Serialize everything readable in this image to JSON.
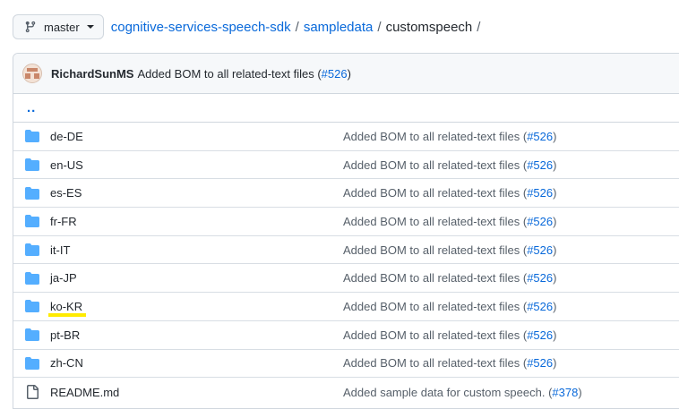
{
  "branch": {
    "label": "master",
    "icon": "git-branch-icon"
  },
  "breadcrumb": {
    "repo": "cognitive-services-speech-sdk",
    "folder": "sampledata",
    "current": "customspeech",
    "separator": "/"
  },
  "latest_commit": {
    "author": "RichardSunMS",
    "message": "Added BOM to all related-text files (",
    "pr": "#526",
    "suffix": ")"
  },
  "parent_link": "..",
  "files": [
    {
      "name": "de-DE",
      "type": "folder",
      "msg": "Added BOM to all related-text files (",
      "pr": "#526",
      "suffix": ")"
    },
    {
      "name": "en-US",
      "type": "folder",
      "msg": "Added BOM to all related-text files (",
      "pr": "#526",
      "suffix": ")"
    },
    {
      "name": "es-ES",
      "type": "folder",
      "msg": "Added BOM to all related-text files (",
      "pr": "#526",
      "suffix": ")"
    },
    {
      "name": "fr-FR",
      "type": "folder",
      "msg": "Added BOM to all related-text files (",
      "pr": "#526",
      "suffix": ")"
    },
    {
      "name": "it-IT",
      "type": "folder",
      "msg": "Added BOM to all related-text files (",
      "pr": "#526",
      "suffix": ")"
    },
    {
      "name": "ja-JP",
      "type": "folder",
      "msg": "Added BOM to all related-text files (",
      "pr": "#526",
      "suffix": ")"
    },
    {
      "name": "ko-KR",
      "type": "folder",
      "msg": "Added BOM to all related-text files (",
      "pr": "#526",
      "suffix": ")",
      "highlighted": true
    },
    {
      "name": "pt-BR",
      "type": "folder",
      "msg": "Added BOM to all related-text files (",
      "pr": "#526",
      "suffix": ")"
    },
    {
      "name": "zh-CN",
      "type": "folder",
      "msg": "Added BOM to all related-text files (",
      "pr": "#526",
      "suffix": ")"
    },
    {
      "name": "README.md",
      "type": "file",
      "msg": "Added sample data for custom speech. (",
      "pr": "#378",
      "suffix": ")"
    }
  ],
  "colors": {
    "link": "#0969da",
    "folder": "#54aeff",
    "highlight": "#ffeb00"
  }
}
